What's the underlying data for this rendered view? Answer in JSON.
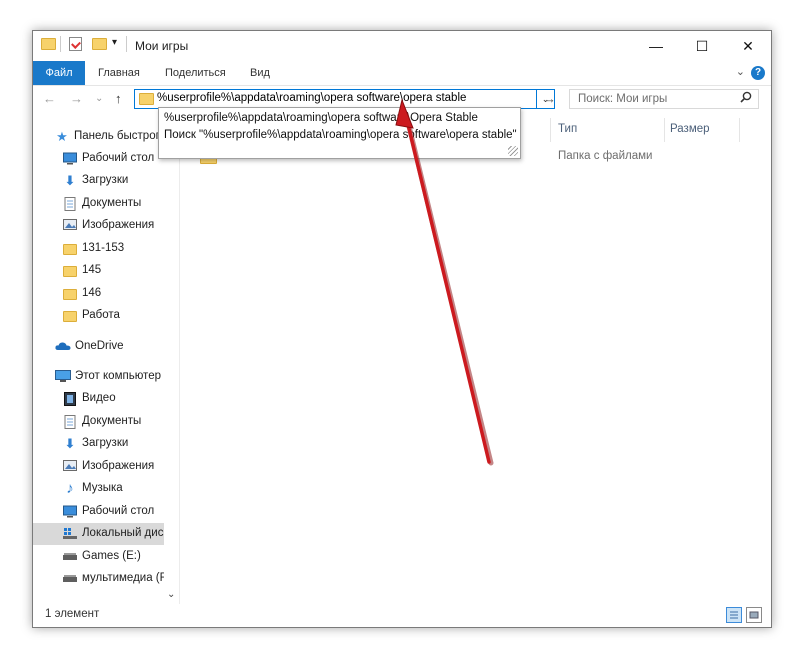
{
  "window": {
    "title": "Мои игры",
    "qat_dropdown_glyph": "▾",
    "controls": {
      "minimize": "—",
      "maximize": "☐",
      "close": "✕"
    }
  },
  "ribbon": {
    "tabs": [
      "Файл",
      "Главная",
      "Поделиться",
      "Вид"
    ],
    "help": "?",
    "collapse_glyph": "⌄"
  },
  "navigation": {
    "back": "←",
    "forward": "→",
    "recent": "⌄",
    "up": "↑"
  },
  "address_bar": {
    "value": "%userprofile%\\appdata\\roaming\\opera software\\opera stable",
    "dropdown_glyph": "⌄",
    "go_glyph": "→"
  },
  "search": {
    "placeholder": "Поиск: Мои игры",
    "icon": "search-icon"
  },
  "autocomplete": {
    "items": [
      "%userprofile%\\appdata\\roaming\\opera software\\Opera Stable",
      "Поиск \"%userprofile%\\appdata\\roaming\\opera software\\opera stable\""
    ]
  },
  "sidebar": {
    "items": [
      {
        "label": "Панель быстрого доступа",
        "icon": "star-icon",
        "pinned": false
      },
      {
        "label": "Рабочий стол",
        "icon": "desktop-icon",
        "pinned": true
      },
      {
        "label": "Загрузки",
        "icon": "download-icon",
        "pinned": true
      },
      {
        "label": "Документы",
        "icon": "document-icon",
        "pinned": true
      },
      {
        "label": "Изображения",
        "icon": "pictures-icon",
        "pinned": true
      },
      {
        "label": "131-153",
        "icon": "folder-icon",
        "pinned": false
      },
      {
        "label": "145",
        "icon": "folder-icon",
        "pinned": false
      },
      {
        "label": "146",
        "icon": "folder-icon",
        "pinned": false
      },
      {
        "label": "Работа",
        "icon": "folder-icon",
        "pinned": false
      },
      {
        "label": "OneDrive",
        "icon": "cloud-icon",
        "pinned": false
      },
      {
        "label": "Этот компьютер",
        "icon": "computer-icon",
        "pinned": false
      },
      {
        "label": "Видео",
        "icon": "video-icon",
        "pinned": false
      },
      {
        "label": "Документы",
        "icon": "document-icon",
        "pinned": false
      },
      {
        "label": "Загрузки",
        "icon": "download-icon",
        "pinned": false
      },
      {
        "label": "Изображения",
        "icon": "pictures-icon",
        "pinned": false
      },
      {
        "label": "Музыка",
        "icon": "music-icon",
        "pinned": false
      },
      {
        "label": "Рабочий стол",
        "icon": "desktop-icon",
        "pinned": false
      },
      {
        "label": "Локальный диск (C:)",
        "icon": "system-drive-icon",
        "pinned": false,
        "selected": true
      },
      {
        "label": "Games (E:)",
        "icon": "drive-icon",
        "pinned": false
      },
      {
        "label": "мультимедиа (F:)",
        "icon": "drive-icon",
        "pinned": false
      }
    ],
    "pin_glyph": "📌",
    "scroll_down_glyph": "⌄"
  },
  "content": {
    "columns": [
      "Тип",
      "Размер"
    ],
    "rows": [
      {
        "type": "Папка с файлами"
      }
    ]
  },
  "statusbar": {
    "text": "1 элемент"
  },
  "colors": {
    "accent": "#1979ca",
    "arrow": "#c8181e",
    "folder": "#f7d26b"
  }
}
